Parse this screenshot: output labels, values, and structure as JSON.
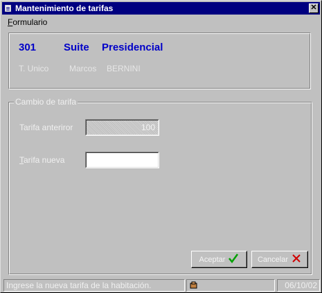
{
  "window": {
    "title": "Mantenimiento de tarifas",
    "close_glyph": "✕"
  },
  "menu": {
    "items": [
      {
        "label_first": "F",
        "label_rest": "ormulario"
      }
    ]
  },
  "room": {
    "number": "301",
    "type": "Suite",
    "name": "Presidencial",
    "occupancy": "T. Unico",
    "guest_first": "Marcos",
    "guest_last": "BERNINI"
  },
  "form": {
    "group_title": "Cambio de tarifa",
    "old_rate_label": "Tarifa anteriror",
    "old_rate_value": "100",
    "new_rate_label_first": "T",
    "new_rate_label_rest": "arifa nueva",
    "new_rate_value": ""
  },
  "buttons": {
    "ok_label": "Aceptar",
    "ok_icon": "check-icon",
    "cancel_label": "Cancelar",
    "cancel_icon": "x-icon"
  },
  "status": {
    "message": "Ingrese la nueva tarifa de la habitación.",
    "date": "06/10/02"
  },
  "colors": {
    "title_bar": "#000080",
    "room_text": "#0000c8",
    "face": "#c0c0c0"
  }
}
